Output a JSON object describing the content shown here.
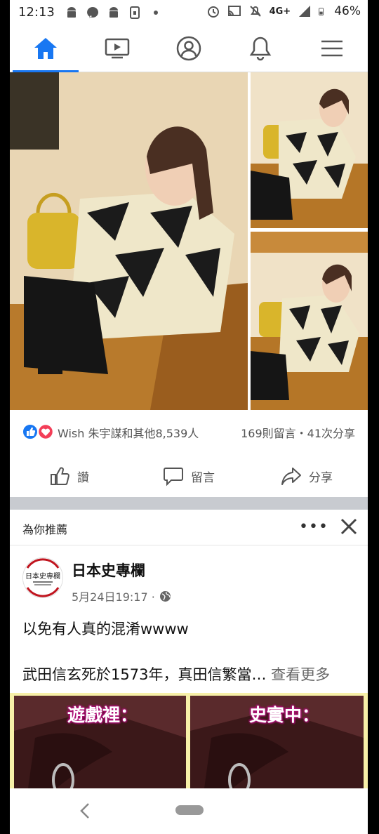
{
  "status_bar": {
    "time": "12:13",
    "network": "4G+",
    "battery": "46%",
    "left_icons": [
      "android-icon",
      "messenger-icon",
      "android-icon",
      "sim-icon",
      "dot-icon"
    ],
    "right_icons": [
      "alarm-icon",
      "cast-icon",
      "mute-icon",
      "signal-icon",
      "battery-icon"
    ]
  },
  "top_nav": {
    "items": [
      {
        "name": "home",
        "icon": "home-icon",
        "active": true
      },
      {
        "name": "watch",
        "icon": "video-icon",
        "active": false
      },
      {
        "name": "profile",
        "icon": "profile-icon",
        "active": false
      },
      {
        "name": "notifications",
        "icon": "bell-icon",
        "active": false
      },
      {
        "name": "menu",
        "icon": "menu-icon",
        "active": false
      }
    ],
    "accent_color": "#1877f2"
  },
  "post1": {
    "reactions": {
      "names_text": "Wish 朱宇謀和其他8,539人",
      "counts_text": "169則留言・41次分享",
      "icons": [
        "like-icon",
        "love-icon"
      ]
    },
    "actions": {
      "like": "讚",
      "comment": "留言",
      "share": "分享"
    }
  },
  "recommendation": {
    "header": "為你推薦",
    "more": "•••"
  },
  "post2": {
    "avatar_text": "日本史専欄",
    "page_name": "日本史專欄",
    "timestamp": "5月24日19:17 ·",
    "line1": "以免有人真的混淆wwww",
    "line2": "武田信玄死於1573年，真田信繁當…",
    "see_more": "查看更多",
    "image_captions": {
      "left": "遊戲裡：",
      "right": "史實中："
    }
  }
}
